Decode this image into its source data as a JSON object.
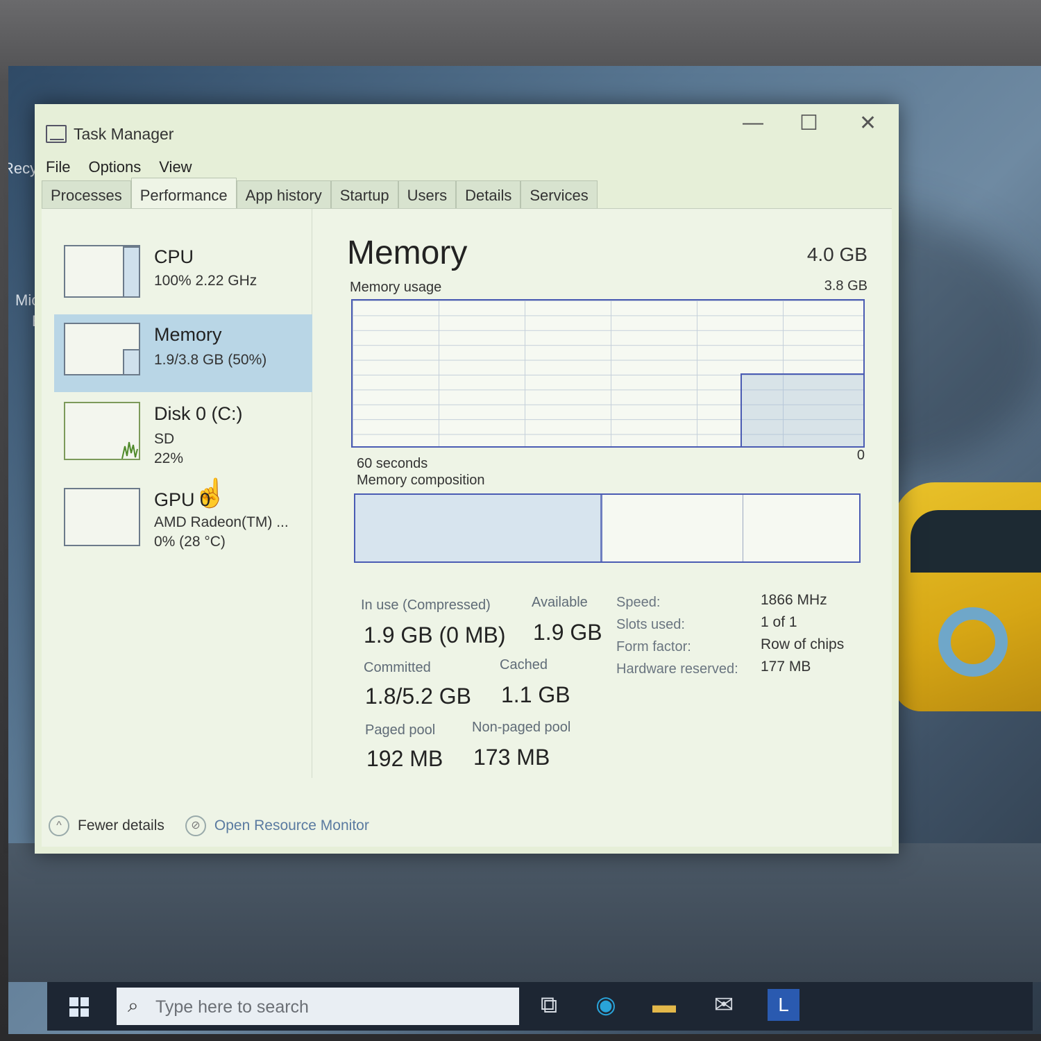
{
  "window": {
    "title": "Task Manager",
    "controls": {
      "minimize": "—",
      "maximize": "☐",
      "close": "✕"
    }
  },
  "menu": [
    "File",
    "Options",
    "View"
  ],
  "tabs": [
    {
      "label": "Processes",
      "active": false
    },
    {
      "label": "Performance",
      "active": true
    },
    {
      "label": "App history",
      "active": false
    },
    {
      "label": "Startup",
      "active": false
    },
    {
      "label": "Users",
      "active": false
    },
    {
      "label": "Details",
      "active": false
    },
    {
      "label": "Services",
      "active": false
    }
  ],
  "sidebar": {
    "cpu": {
      "title": "CPU",
      "line1": "100%  2.22 GHz",
      "usage_fraction": 1.0
    },
    "memory": {
      "title": "Memory",
      "line1": "1.9/3.8 GB (50%)",
      "usage_fraction": 0.5
    },
    "disk": {
      "title": "Disk 0 (C:)",
      "line1": "SD",
      "line2": "22%"
    },
    "gpu": {
      "title": "GPU 0",
      "line1": "AMD Radeon(TM) ...",
      "line2": "0%  (28 °C)"
    }
  },
  "main": {
    "title": "Memory",
    "total": "4.0 GB",
    "usage_label": "Memory usage",
    "usage_max": "3.8 GB",
    "time_label": "60 seconds",
    "zero_label": "0",
    "composition_label": "Memory composition",
    "composition": {
      "in_use_fraction": 0.49,
      "cached_fraction": 0.28
    }
  },
  "stats": {
    "in_use": {
      "label": "In use (Compressed)",
      "value": "1.9 GB (0 MB)"
    },
    "available": {
      "label": "Available",
      "value": "1.9 GB"
    },
    "committed": {
      "label": "Committed",
      "value": "1.8/5.2 GB"
    },
    "cached": {
      "label": "Cached",
      "value": "1.1 GB"
    },
    "paged_pool": {
      "label": "Paged pool",
      "value": "192 MB"
    },
    "non_paged_pool": {
      "label": "Non-paged pool",
      "value": "173 MB"
    }
  },
  "specs": {
    "speed": {
      "label": "Speed:",
      "value": "1866 MHz"
    },
    "slots": {
      "label": "Slots used:",
      "value": "1 of 1"
    },
    "form_factor": {
      "label": "Form factor:",
      "value": "Row of chips"
    },
    "hw_reserved": {
      "label": "Hardware reserved:",
      "value": "177 MB"
    }
  },
  "footer": {
    "fewer_details": "Fewer details",
    "open_resource_monitor": "Open Resource Monitor"
  },
  "desktop": {
    "recycle_label": "Recy",
    "edge_label_1": "Mic",
    "edge_label_2": "Ed"
  },
  "taskbar": {
    "search_placeholder": "Type here to search",
    "tile_letter": "L"
  }
}
